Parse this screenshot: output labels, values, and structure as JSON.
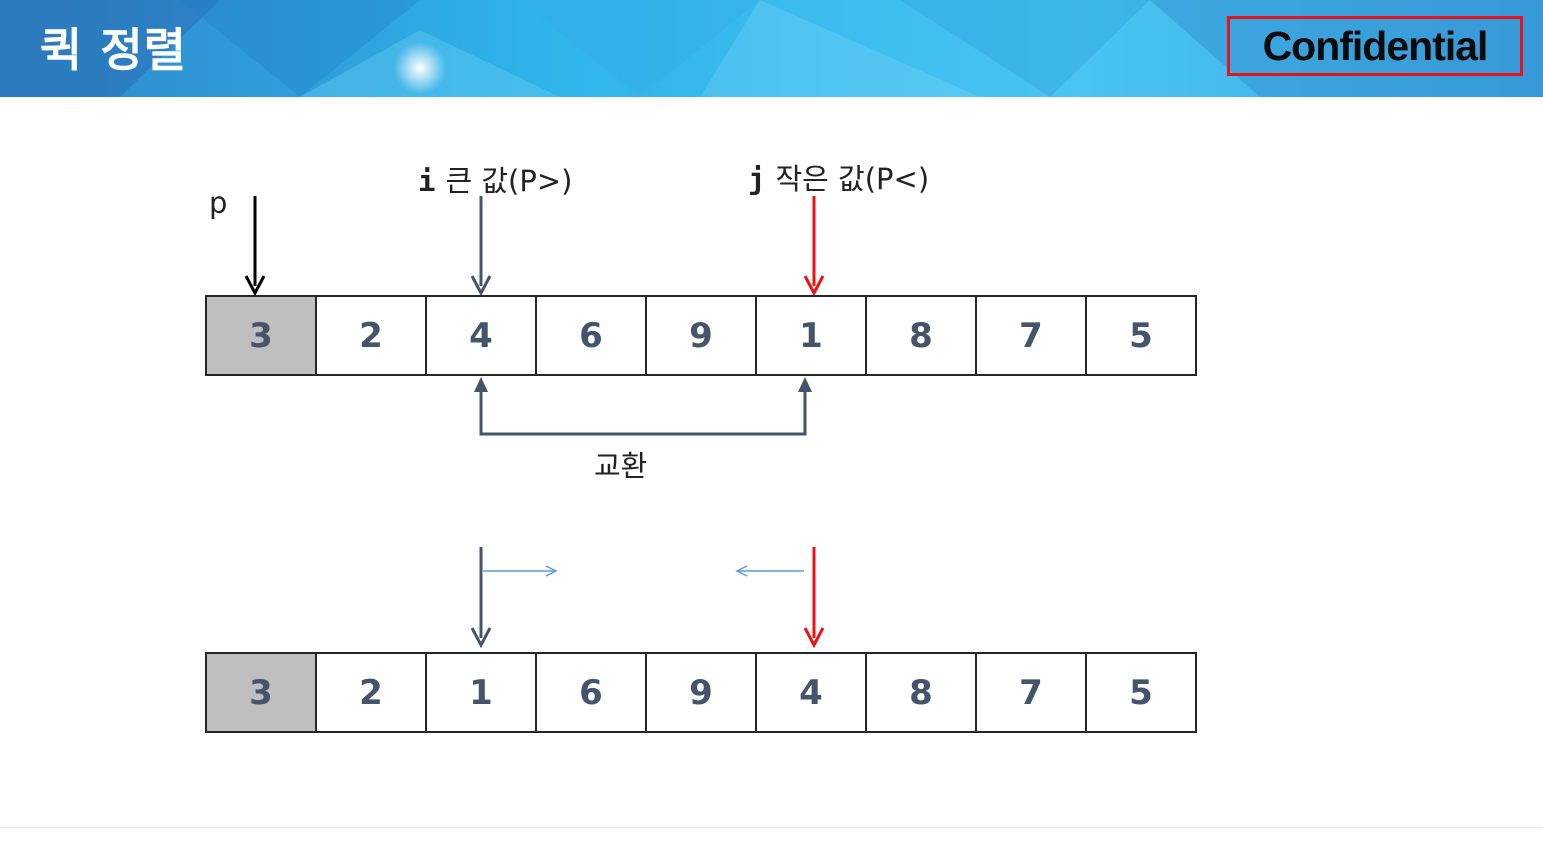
{
  "header": {
    "title": "퀵 정렬",
    "badge": "Confidential"
  },
  "colors": {
    "pointer_i": "#44546a",
    "pointer_j": "#ee1111",
    "pointer_p": "#000000",
    "pivot_cell": "#bfbfbf",
    "move_arrow": "#5b9bd5"
  },
  "labels": {
    "p": "p",
    "i_var": "i",
    "i_desc": "큰 값(P>)",
    "j_var": "j",
    "j_desc": "작은 값(P<)",
    "swap": "교환"
  },
  "arrays": {
    "before": [
      "3",
      "2",
      "4",
      "6",
      "9",
      "1",
      "8",
      "7",
      "5"
    ],
    "after": [
      "3",
      "2",
      "1",
      "6",
      "9",
      "4",
      "8",
      "7",
      "5"
    ]
  }
}
